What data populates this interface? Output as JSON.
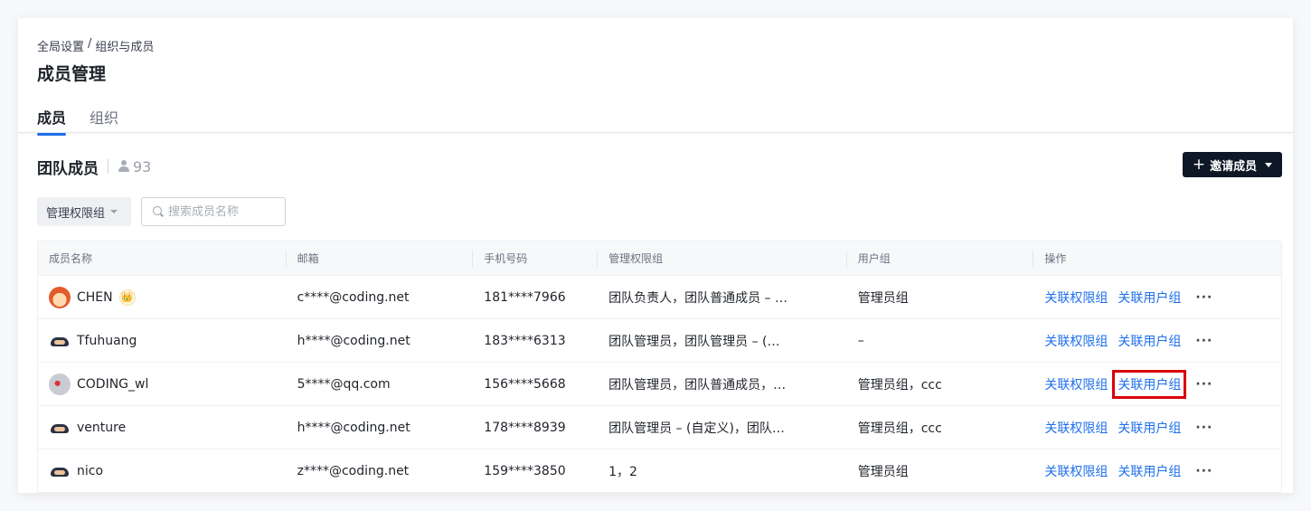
{
  "breadcrumb": [
    "全局设置",
    "/",
    "组织与成员"
  ],
  "page_title": "成员管理",
  "tabs": [
    {
      "label": "成员",
      "active": true
    },
    {
      "label": "组织",
      "active": false
    }
  ],
  "section": {
    "title": "团队成员",
    "count": "93",
    "invite_label": "邀请成员"
  },
  "filters": {
    "group_select": "管理权限组",
    "search_placeholder": "搜索成员名称"
  },
  "table": {
    "headers": [
      "成员名称",
      "邮箱",
      "手机号码",
      "管理权限组",
      "用户组",
      "操作"
    ],
    "rows": [
      {
        "name": "CHEN",
        "email": "c****@coding.net",
        "phone": "181****7966",
        "perm": "团队负责人，团队普通成员 – …",
        "group": "管理员组",
        "avatar": "orange",
        "crown": true
      },
      {
        "name": "Tfuhuang",
        "email": "h****@coding.net",
        "phone": "183****6313",
        "perm": "团队管理员，团队管理员 – (…",
        "group": "–",
        "avatar": "octo",
        "crown": false
      },
      {
        "name": "CODING_wl",
        "email": "5****@qq.com",
        "phone": "156****5668",
        "perm": "团队管理员，团队普通成员，…",
        "group": "管理员组，ccc",
        "avatar": "photo",
        "crown": false
      },
      {
        "name": "venture",
        "email": "h****@coding.net",
        "phone": "178****8939",
        "perm": "团队管理员 – (自定义)，团队…",
        "group": "管理员组，ccc",
        "avatar": "octo",
        "crown": false
      },
      {
        "name": "nico",
        "email": "z****@coding.net",
        "phone": "159****3850",
        "perm": "1，2",
        "group": "管理员组",
        "avatar": "octo",
        "crown": false
      }
    ],
    "action_labels": {
      "perm": "关联权限组",
      "group": "关联用户组",
      "more": "···"
    }
  },
  "crown_icon": "👑",
  "colors": {
    "accent": "#1f6feb",
    "primary_button": "#0e1726",
    "highlight": "#d9000a"
  }
}
